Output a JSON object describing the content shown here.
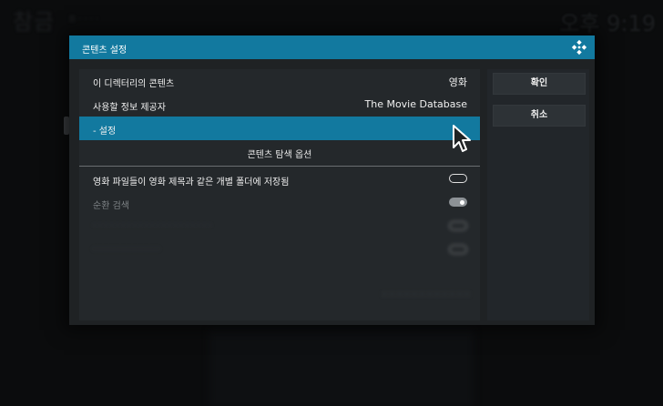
{
  "background": {
    "title": "참금",
    "subtitle": "B · · · ·",
    "clock": "오후 9:19"
  },
  "dialog": {
    "title": "콘텐츠 설정",
    "icon": "kodi-icon"
  },
  "rows": [
    {
      "label": "이 디렉터리의 콘텐츠",
      "value": "영화"
    },
    {
      "label": "사용할 정보 제공자",
      "value": "The Movie Database"
    },
    {
      "label": "- 설정",
      "value": ""
    },
    {
      "label": "콘텐츠 탐색 옵션",
      "value": ""
    },
    {
      "label": "영화 파일들이 영화 제목과 같은 개별 폴더에 저장됨",
      "toggle": "off"
    },
    {
      "label": "순환 검색",
      "toggle": "on"
    },
    {
      "label": "· · · · · · · · · · · · · · · · · · · · ·",
      "toggle": "off"
    },
    {
      "label": "· · · · · · · · · · · ·",
      "toggle": "off"
    }
  ],
  "buttons": {
    "ok": "확인",
    "cancel": "취소"
  },
  "overlay_text": "· · · · · · · · · · · ·",
  "colors": {
    "accent": "#12799f",
    "panel": "#24282b",
    "button": "#2d3236"
  }
}
